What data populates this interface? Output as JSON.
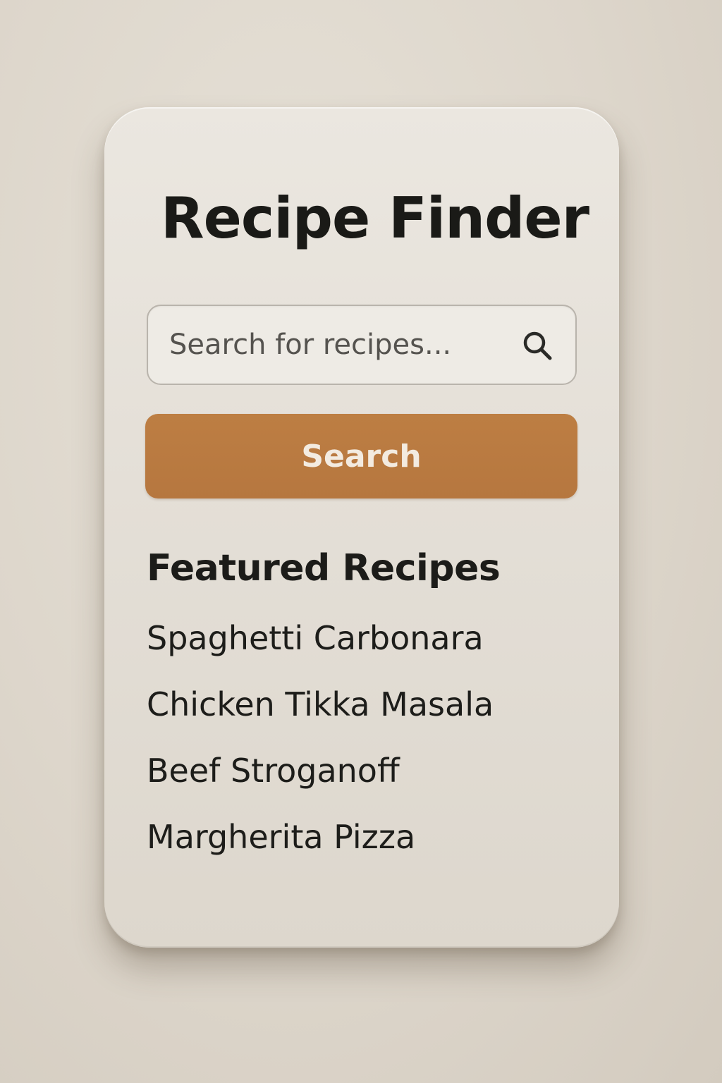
{
  "app": {
    "title": "Recipe Finder"
  },
  "search": {
    "placeholder": "Search for recipes...",
    "value": "",
    "button_label": "Search",
    "icon": "search-icon"
  },
  "featured": {
    "heading": "Featured Recipes",
    "items": [
      {
        "label": "Spaghetti Carbonara"
      },
      {
        "label": "Chicken Tikka Masala"
      },
      {
        "label": "Beef Stroganoff"
      },
      {
        "label": "Margherita Pizza"
      }
    ]
  },
  "colors": {
    "accent": "#b87a40",
    "background": "#ddd6cb",
    "card": "#e6e2da",
    "text": "#1a1a17"
  }
}
